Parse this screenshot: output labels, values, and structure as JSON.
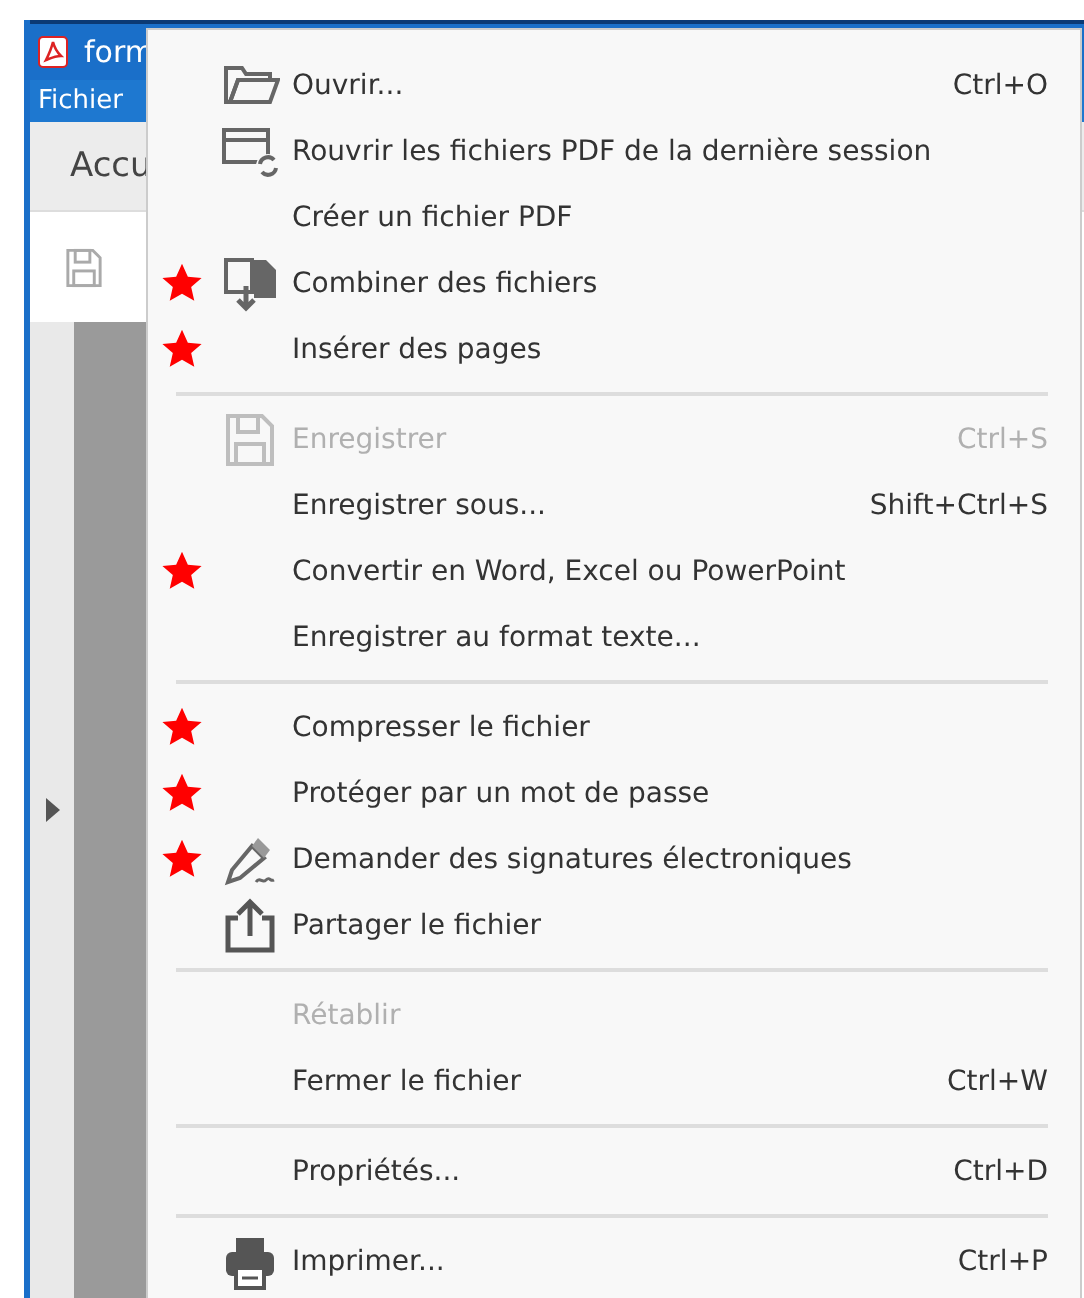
{
  "app": {
    "title": "form",
    "menubar": [
      "Fichier"
    ],
    "tabs": [
      "Accu"
    ]
  },
  "menu": {
    "groups": [
      {
        "items": [
          {
            "label": "Ouvrir...",
            "shortcut": "Ctrl+O",
            "kind": "folder",
            "disabled": false,
            "starred": false
          },
          {
            "label": "Rouvrir les fichiers PDF de la dernière session",
            "kind": "reopen",
            "disabled": false,
            "starred": false
          },
          {
            "label": "Créer un fichier PDF",
            "disabled": false,
            "starred": false
          },
          {
            "label": "Combiner des fichiers",
            "kind": "combine",
            "disabled": false,
            "starred": true
          },
          {
            "label": "Insérer des pages",
            "disabled": false,
            "starred": true
          }
        ]
      },
      {
        "items": [
          {
            "label": "Enregistrer",
            "shortcut": "Ctrl+S",
            "kind": "save",
            "disabled": true,
            "starred": false
          },
          {
            "label": "Enregistrer sous...",
            "shortcut": "Shift+Ctrl+S",
            "disabled": false,
            "starred": false
          },
          {
            "label": "Convertir en Word, Excel ou PowerPoint",
            "disabled": false,
            "starred": true
          },
          {
            "label": "Enregistrer au format texte...",
            "disabled": false,
            "starred": false
          }
        ]
      },
      {
        "items": [
          {
            "label": "Compresser le fichier",
            "disabled": false,
            "starred": true
          },
          {
            "label": "Protéger par un mot de passe",
            "disabled": false,
            "starred": true
          },
          {
            "label": "Demander des signatures électroniques",
            "kind": "signature",
            "disabled": false,
            "starred": true
          },
          {
            "label": "Partager le fichier",
            "kind": "share",
            "disabled": false,
            "starred": false
          }
        ]
      },
      {
        "items": [
          {
            "label": "Rétablir",
            "disabled": true,
            "starred": false
          },
          {
            "label": "Fermer le fichier",
            "shortcut": "Ctrl+W",
            "disabled": false,
            "starred": false
          }
        ]
      },
      {
        "items": [
          {
            "label": "Propriétés...",
            "shortcut": "Ctrl+D",
            "disabled": false,
            "starred": false
          }
        ]
      },
      {
        "items": [
          {
            "label": "Imprimer...",
            "shortcut": "Ctrl+P",
            "kind": "printer",
            "disabled": false,
            "starred": false
          }
        ]
      }
    ]
  }
}
